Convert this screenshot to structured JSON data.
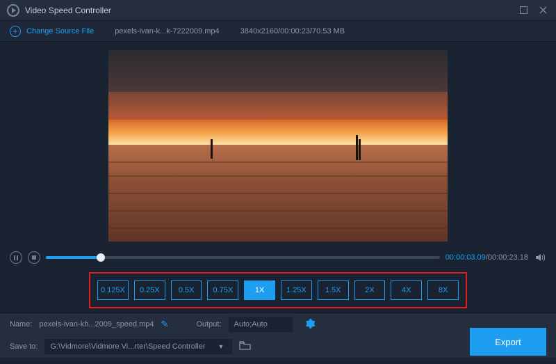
{
  "titlebar": {
    "title": "Video Speed Controller"
  },
  "source": {
    "change_label": "Change Source File",
    "filename": "pexels-ivan-k...k-7222009.mp4",
    "meta": "3840x2160/00:00:23/70.53 MB"
  },
  "playback": {
    "current": "00:00:03.09",
    "total": "00:00:23.18"
  },
  "speeds": [
    "0.125X",
    "0.25X",
    "0.5X",
    "0.75X",
    "1X",
    "1.25X",
    "1.5X",
    "2X",
    "4X",
    "8X"
  ],
  "active_speed_index": 4,
  "footer": {
    "name_label": "Name:",
    "name_value": "pexels-ivan-kh...2009_speed.mp4",
    "output_label": "Output:",
    "output_value": "Auto;Auto",
    "saveto_label": "Save to:",
    "saveto_value": "G:\\Vidmore\\Vidmore Vi...rter\\Speed Controller",
    "export_label": "Export"
  }
}
